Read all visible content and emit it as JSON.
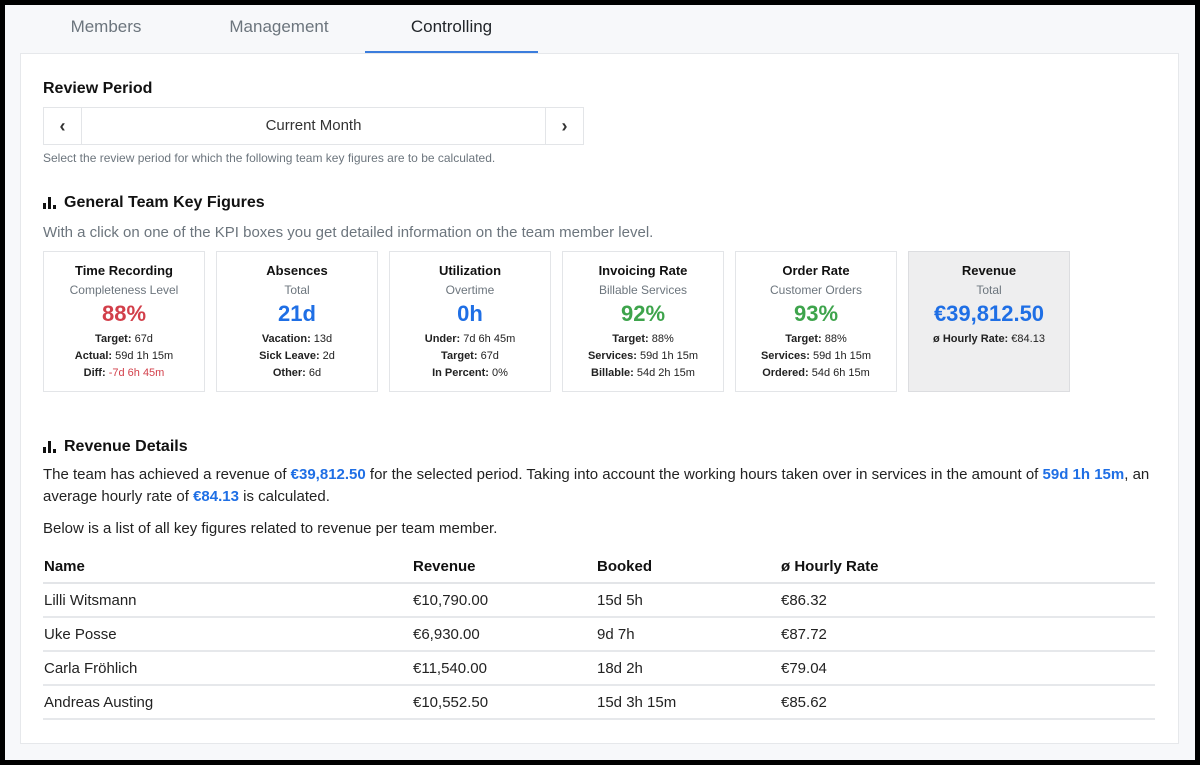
{
  "tabs": [
    {
      "label": "Members",
      "active": false
    },
    {
      "label": "Management",
      "active": false
    },
    {
      "label": "Controlling",
      "active": true
    }
  ],
  "review_period": {
    "title": "Review Period",
    "prev_icon": "chevron-left-icon",
    "next_icon": "chevron-right-icon",
    "prev_glyph": "‹",
    "next_glyph": "›",
    "current": "Current Month",
    "help": "Select the review period for which the following team key figures are to be calculated."
  },
  "key_figures": {
    "title": "General Team Key Figures",
    "icon": "bar-chart-icon",
    "description": "With a click on one of the KPI boxes you get detailed information on the team member level.",
    "kpis": [
      {
        "title": "Time Recording",
        "subtitle": "Completeness Level",
        "value": "88%",
        "color": "#d23f4a",
        "lines": [
          {
            "label": "Target:",
            "value": " 67d"
          },
          {
            "label": "Actual:",
            "value": " 59d 1h 15m"
          },
          {
            "label": "Diff:",
            "value": " -7d 6h 45m",
            "color": "#d23f4a"
          }
        ]
      },
      {
        "title": "Absences",
        "subtitle": "Total",
        "value": "21d",
        "color": "#1f6fe5",
        "lines": [
          {
            "label": "Vacation:",
            "value": " 13d"
          },
          {
            "label": "Sick Leave:",
            "value": " 2d"
          },
          {
            "label": "Other:",
            "value": " 6d"
          }
        ]
      },
      {
        "title": "Utilization",
        "subtitle": "Overtime",
        "value": "0h",
        "color": "#1f6fe5",
        "lines": [
          {
            "label": "Under:",
            "value": " 7d 6h 45m"
          },
          {
            "label": "Target:",
            "value": " 67d"
          },
          {
            "label": "In Percent:",
            "value": " 0%"
          }
        ]
      },
      {
        "title": "Invoicing Rate",
        "subtitle": "Billable Services",
        "value": "92%",
        "color": "#3ea44c",
        "lines": [
          {
            "label": "Target:",
            "value": " 88%"
          },
          {
            "label": "Services:",
            "value": " 59d 1h 15m"
          },
          {
            "label": "Billable:",
            "value": " 54d 2h 15m"
          }
        ]
      },
      {
        "title": "Order Rate",
        "subtitle": "Customer Orders",
        "value": "93%",
        "color": "#3ea44c",
        "lines": [
          {
            "label": "Target:",
            "value": " 88%"
          },
          {
            "label": "Services:",
            "value": " 59d 1h 15m"
          },
          {
            "label": "Ordered:",
            "value": " 54d 6h 15m"
          }
        ]
      },
      {
        "title": "Revenue",
        "subtitle": "Total",
        "value": "€39,812.50",
        "color": "#1f6fe5",
        "selected": true,
        "lines": [
          {
            "label": "ø Hourly Rate:",
            "value": " €84.13"
          }
        ]
      }
    ]
  },
  "revenue_details": {
    "title": "Revenue Details",
    "icon": "bar-chart-icon",
    "text_parts": [
      {
        "t": "The team has achieved a revenue of ",
        "hl": false
      },
      {
        "t": "€39,812.50",
        "hl": true
      },
      {
        "t": " for the selected period. Taking into account the working hours taken over in services in the amount of ",
        "hl": false
      },
      {
        "t": "59d 1h 15m",
        "hl": true
      },
      {
        "t": ", an average hourly rate of ",
        "hl": false
      },
      {
        "t": "€84.13",
        "hl": true
      },
      {
        "t": " is calculated.",
        "hl": false
      }
    ],
    "list_intro": "Below is a list of all key figures related to revenue per team member.",
    "table": {
      "headers": [
        "Name",
        "Revenue",
        "Booked",
        "ø Hourly Rate"
      ],
      "rows": [
        [
          "Lilli Witsmann",
          "€10,790.00",
          "15d 5h",
          "€86.32"
        ],
        [
          "Uke Posse",
          "€6,930.00",
          "9d 7h",
          "€87.72"
        ],
        [
          "Carla Fröhlich",
          "€11,540.00",
          "18d 2h",
          "€79.04"
        ],
        [
          "Andreas Austing",
          "€10,552.50",
          "15d 3h 15m",
          "€85.62"
        ]
      ]
    }
  }
}
